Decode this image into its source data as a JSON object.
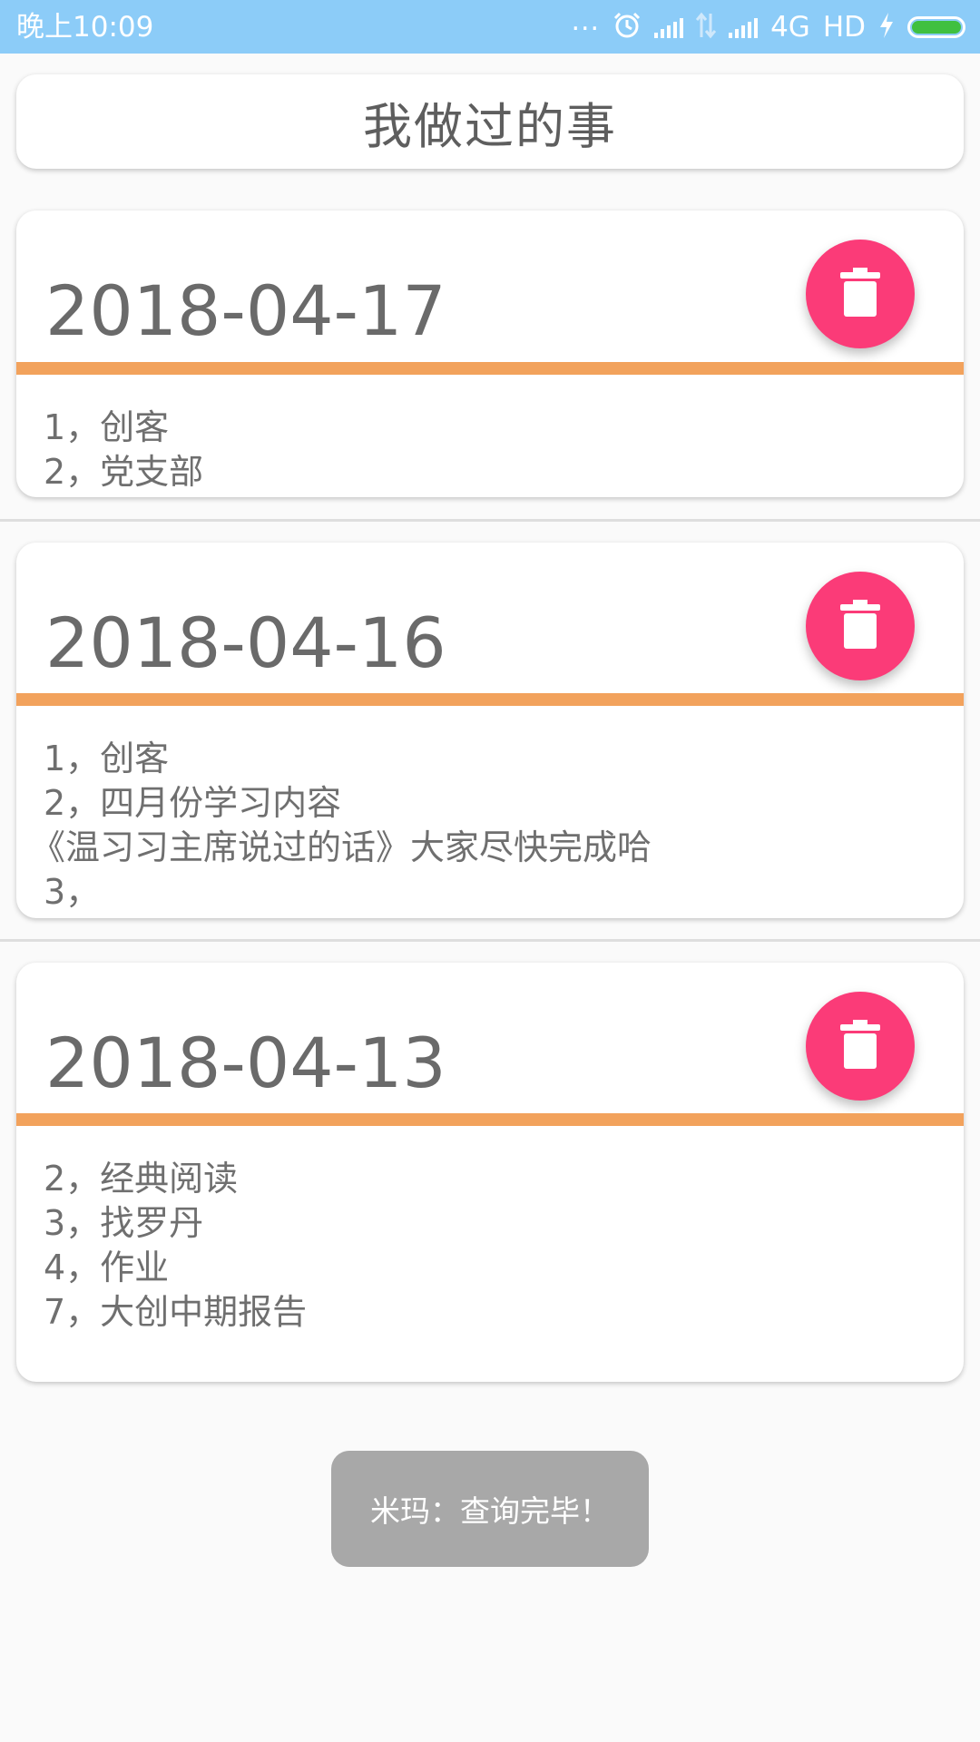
{
  "status_bar": {
    "time": "晚上10:09",
    "dots": "...",
    "network": "4G",
    "hd": "HD",
    "icons": [
      "alarm-icon",
      "signal-icon",
      "data-transfer-icon",
      "signal-icon",
      "charging-icon",
      "battery-icon"
    ],
    "background_color": "#8cccf8"
  },
  "header": {
    "title": "我做过的事"
  },
  "records": [
    {
      "date": "2018-04-17",
      "lines": [
        "1，创客",
        "2，党支部"
      ]
    },
    {
      "date": "2018-04-16",
      "lines": [
        "1，创客",
        "2，四月份学习内容",
        "《温习习主席说过的话》大家尽快完成哈",
        "3，"
      ]
    },
    {
      "date": "2018-04-13",
      "lines": [
        "2，经典阅读",
        "3，找罗丹",
        "4，作业",
        "7，大创中期报告"
      ]
    }
  ],
  "delete_icon": "trash-icon",
  "colors": {
    "accent_line": "#f2a25c",
    "delete_button": "#fb3b78"
  },
  "toast": {
    "message": "米玛：查询完毕！"
  }
}
